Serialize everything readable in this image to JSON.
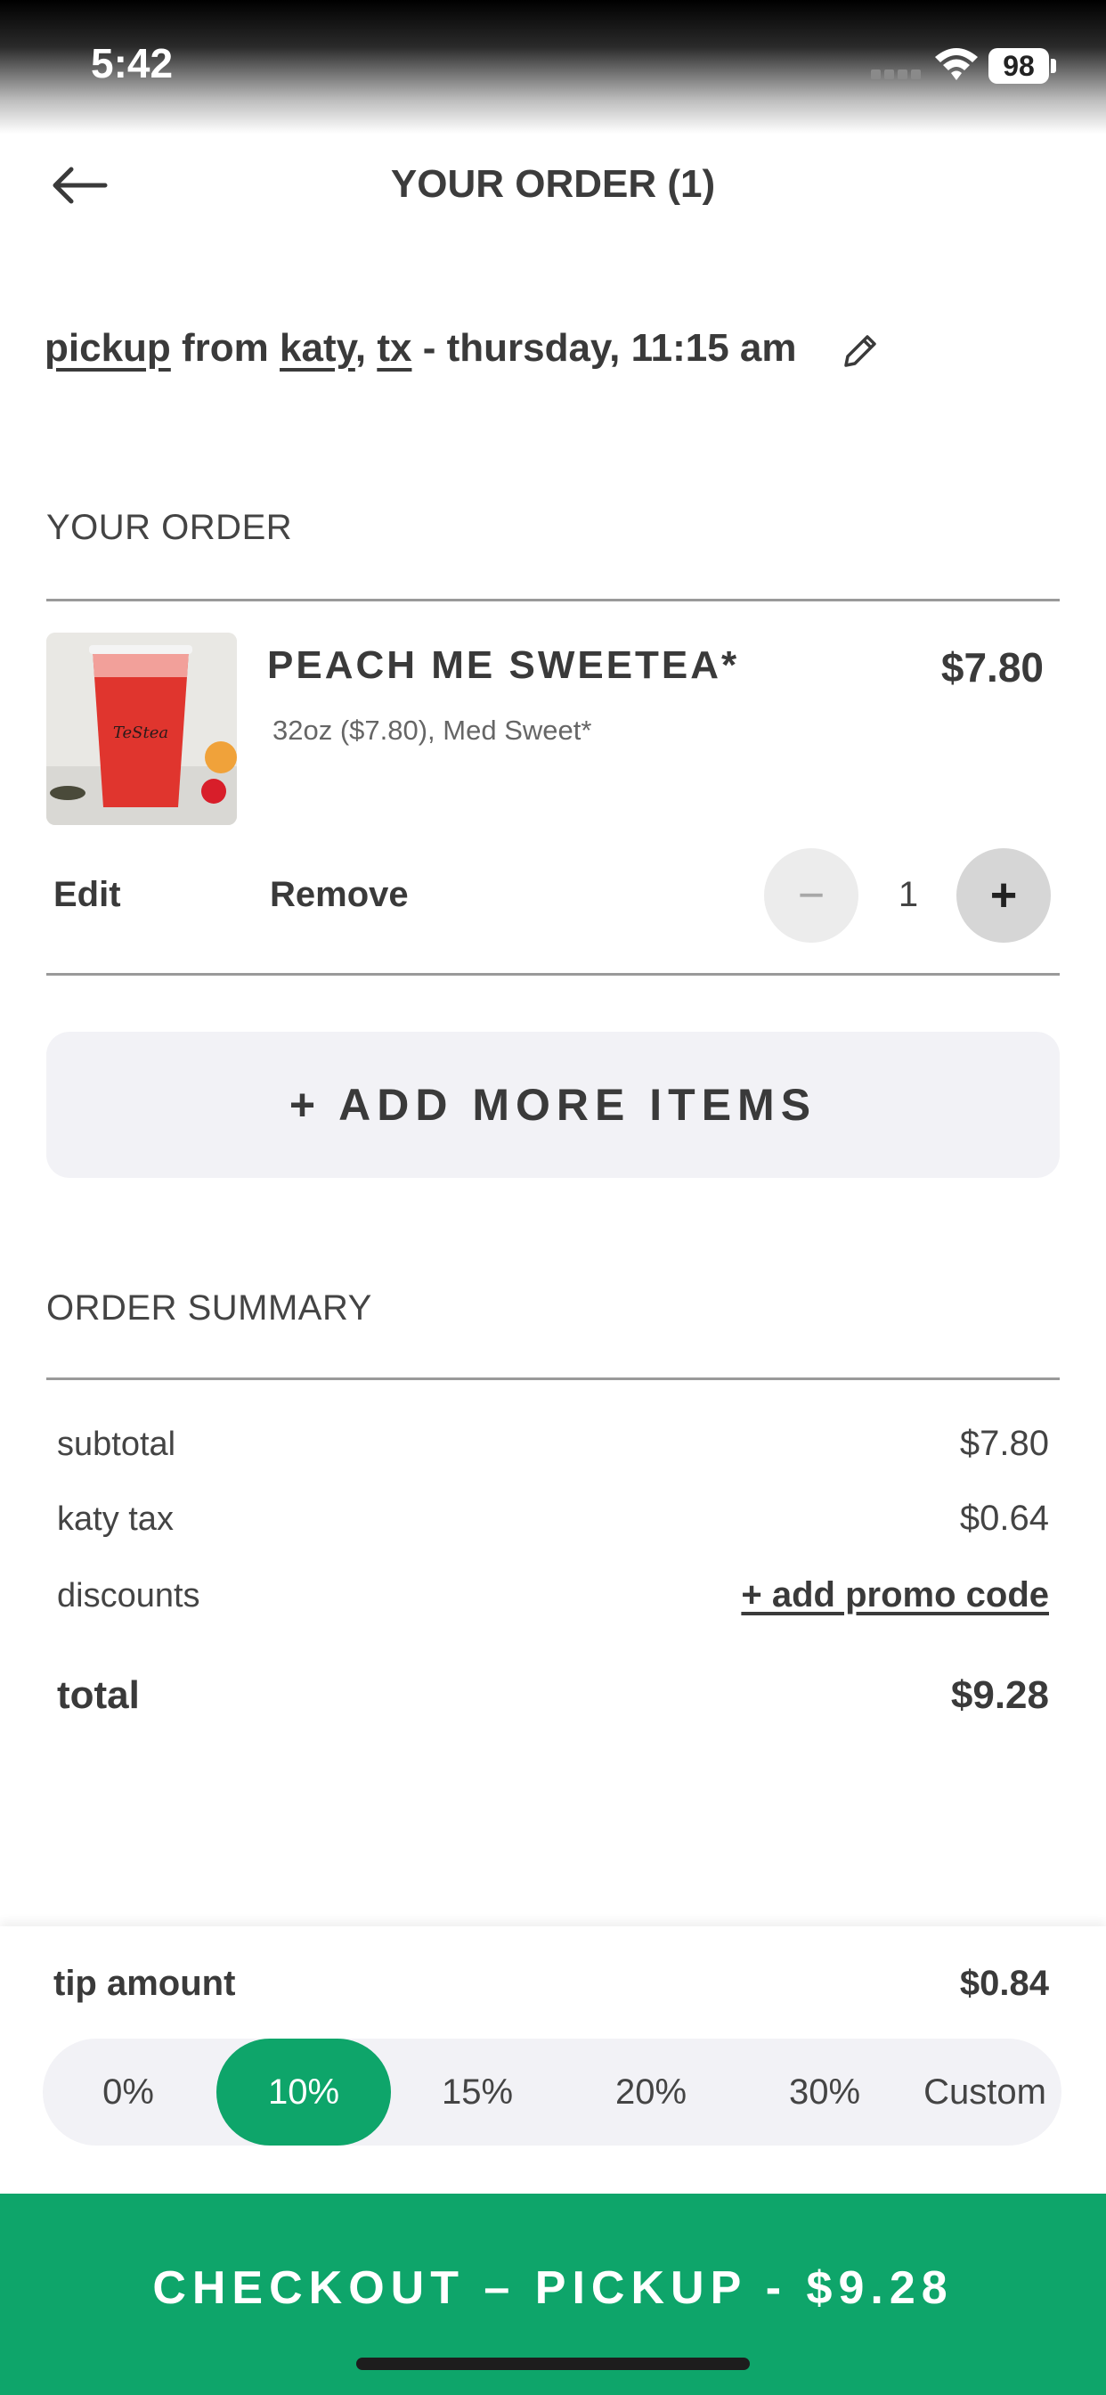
{
  "status_bar": {
    "time": "5:42",
    "battery": "98"
  },
  "header": {
    "title": "YOUR ORDER (1)",
    "back_icon": "back-arrow-icon"
  },
  "pickup": {
    "method": "pickup",
    "from": "from",
    "city": "katy",
    "comma": ",",
    "state": "tx",
    "when": "- thursday, 11:15 am",
    "edit_icon": "pencil-icon"
  },
  "order_section": {
    "title": "YOUR ORDER",
    "items": [
      {
        "name": "PEACH ME SWEETEA*",
        "price": "$7.80",
        "modifiers": "32oz ($7.80), Med Sweet*",
        "edit_label": "Edit",
        "remove_label": "Remove",
        "quantity": "1",
        "minus_symbol": "−",
        "plus_symbol": "+",
        "thumb_cup_text": "TeStea"
      }
    ]
  },
  "add_more_label": "+ ADD MORE ITEMS",
  "summary": {
    "title": "ORDER SUMMARY",
    "subtotal_label": "subtotal",
    "subtotal_value": "$7.80",
    "tax_label": "katy tax",
    "tax_value": "$0.64",
    "discounts_label": "discounts",
    "promo_link": "+ add promo code",
    "total_label": "total",
    "total_value": "$9.28"
  },
  "tip": {
    "label": "tip amount",
    "value": "$0.84",
    "options": [
      "0%",
      "10%",
      "15%",
      "20%",
      "30%",
      "Custom"
    ],
    "selected": "10%"
  },
  "checkout_label": "CHECKOUT – PICKUP - $9.28",
  "colors": {
    "accent": "#0ea56a",
    "text": "#3a3a3a",
    "panel": "#f2f2f6"
  }
}
